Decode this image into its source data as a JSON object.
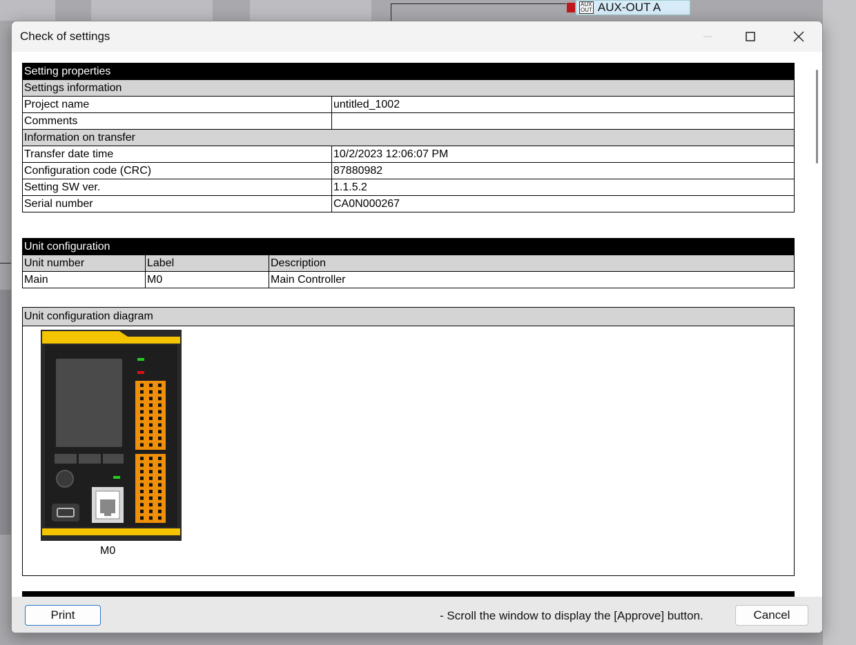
{
  "background": {
    "aux_label": "AUX-OUT A",
    "aux_icon_top": "AUX",
    "aux_icon_bottom": "OUT"
  },
  "dialog": {
    "title": "Check of settings"
  },
  "setting_properties": {
    "header": "Setting properties",
    "settings_information": "Settings information",
    "rows_settings": [
      {
        "label": "Project name",
        "value": "untitled_1002"
      },
      {
        "label": "Comments",
        "value": ""
      }
    ],
    "information_on_transfer": "Information on transfer",
    "rows_transfer": [
      {
        "label": "Transfer date time",
        "value": "10/2/2023 12:06:07 PM"
      },
      {
        "label": "Configuration code (CRC)",
        "value": "87880982"
      },
      {
        "label": "Setting SW ver.",
        "value": "1.1.5.2"
      },
      {
        "label": "Serial number",
        "value": "CA0N000267"
      }
    ]
  },
  "unit_configuration": {
    "header": "Unit configuration",
    "columns": [
      "Unit number",
      "Label",
      "Description"
    ],
    "rows": [
      [
        "Main",
        "M0",
        "Main Controller"
      ]
    ]
  },
  "unit_configuration_diagram": {
    "header": "Unit configuration diagram",
    "module_label": "M0"
  },
  "footer": {
    "print_label": "Print",
    "message": "- Scroll the window to display the [Approve] button.",
    "cancel_label": "Cancel"
  },
  "colors": {
    "module_yellow": "#f5c400",
    "module_body": "#1e1e1e",
    "terminal_orange": "#f0900a",
    "led_green": "#22cc22",
    "led_red": "#e01010"
  }
}
